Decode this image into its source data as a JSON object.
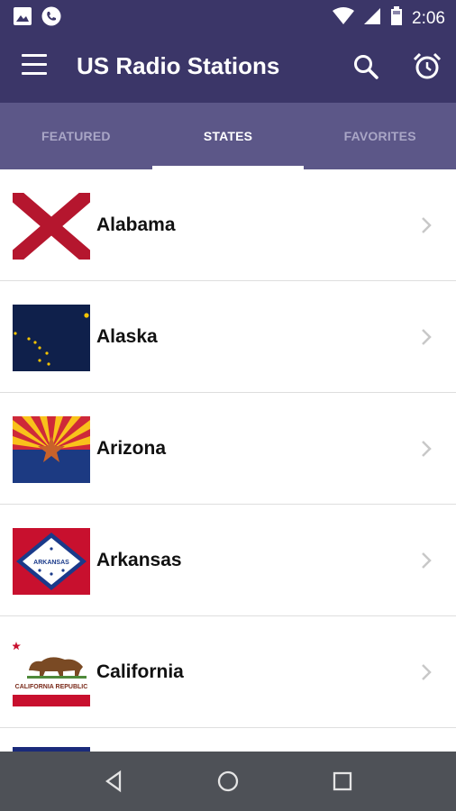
{
  "status_bar": {
    "time": "2:06"
  },
  "app_bar": {
    "title": "US Radio Stations"
  },
  "tabs": [
    {
      "label": "FEATURED",
      "active": false
    },
    {
      "label": "STATES",
      "active": true
    },
    {
      "label": "FAVORITES",
      "active": false
    }
  ],
  "states": [
    {
      "name": "Alabama",
      "flag": "alabama-flag"
    },
    {
      "name": "Alaska",
      "flag": "alaska-flag"
    },
    {
      "name": "Arizona",
      "flag": "arizona-flag"
    },
    {
      "name": "Arkansas",
      "flag": "arkansas-flag",
      "flag_text": "ARKANSAS"
    },
    {
      "name": "California",
      "flag": "california-flag",
      "flag_text": "CALIFORNIA REPUBLIC"
    }
  ],
  "colors": {
    "primary": "#3b3668",
    "tab_bar": "#5c5788",
    "nav_bar": "#4e5157"
  }
}
